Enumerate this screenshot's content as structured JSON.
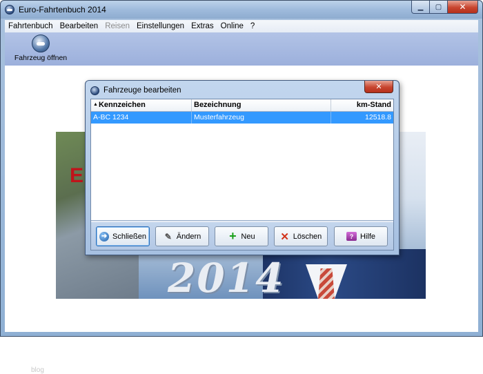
{
  "window": {
    "title": "Euro-Fahrtenbuch 2014"
  },
  "menu": [
    {
      "label": "Fahrtenbuch",
      "enabled": true
    },
    {
      "label": "Bearbeiten",
      "enabled": true
    },
    {
      "label": "Reisen",
      "enabled": false
    },
    {
      "label": "Einstellungen",
      "enabled": true
    },
    {
      "label": "Extras",
      "enabled": true
    },
    {
      "label": "Online",
      "enabled": true
    },
    {
      "label": "?",
      "enabled": true
    }
  ],
  "toolbar": {
    "open_vehicle_label": "Fahrzeug öffnen",
    "open_vehicle_icon": "car-icon"
  },
  "background": {
    "banner_letter": "E",
    "banner_year": "2014",
    "watermark": "blog"
  },
  "dialog": {
    "title": "Fahrzeuge bearbeiten",
    "columns": [
      "Kennzeichen",
      "Bezeichnung",
      "km-Stand"
    ],
    "rows": [
      {
        "plate": "A-BC 1234",
        "name": "Musterfahrzeug",
        "km": "12518.8",
        "selected": true
      }
    ],
    "buttons": {
      "close": "Schließen",
      "edit": "Ändern",
      "new": "Neu",
      "delete": "Löschen",
      "help": "Hilfe"
    }
  },
  "colors": {
    "selection": "#3399ff",
    "accent_red": "#c0141b"
  }
}
